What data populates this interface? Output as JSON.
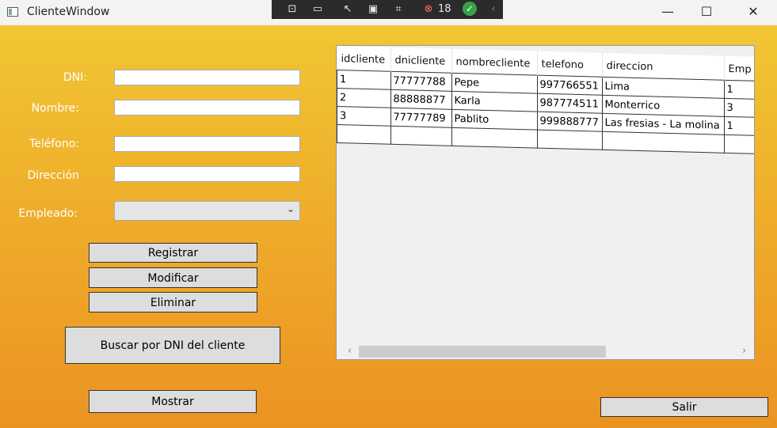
{
  "window": {
    "title": "ClienteWindow",
    "minimize": "—",
    "maximize": "☐",
    "close": "✕"
  },
  "debug_toolbar": {
    "error_count": "18"
  },
  "form": {
    "dni_label": "DNI:",
    "dni_value": "",
    "nombre_label": "Nombre:",
    "nombre_value": "",
    "telefono_label": "Teléfono:",
    "telefono_value": "",
    "direccion_label": "Dirección",
    "direccion_value": "",
    "empleado_label": "Empleado:",
    "empleado_value": ""
  },
  "buttons": {
    "registrar": "Registrar",
    "modificar": "Modificar",
    "eliminar": "Eliminar",
    "buscar": "Buscar por DNI del cliente",
    "mostrar": "Mostrar",
    "salir": "Salir"
  },
  "grid": {
    "columns": [
      "idcliente",
      "dnicliente",
      "nombrecliente",
      "telefono",
      "direccion",
      "Emp"
    ],
    "rows": [
      [
        "1",
        "77777788",
        "Pepe",
        "997766551",
        "Lima",
        "1"
      ],
      [
        "2",
        "88888877",
        "Karla",
        "987774511",
        "Monterrico",
        "3"
      ],
      [
        "3",
        "77777789",
        "Pablito",
        "999888777",
        "Las fresias - La molina",
        "1"
      ],
      [
        "",
        "",
        "",
        "",
        "",
        ""
      ]
    ]
  },
  "colors": {
    "background_top": "#f1c634",
    "background_bottom": "#eb9322",
    "button_face": "#dddddd"
  }
}
